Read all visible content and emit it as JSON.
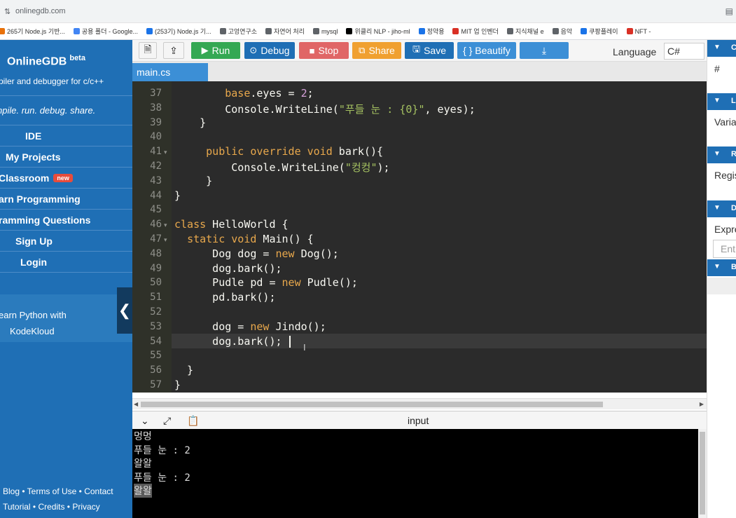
{
  "browser": {
    "url": "onlinegdb.com",
    "bookmarks": [
      {
        "label": "265기 Node.js 기반...",
        "icon_color": "#e8710a"
      },
      {
        "label": "공용 폴더 - Google...",
        "icon_color": "#4285f4"
      },
      {
        "label": "(253기) Node.js 기...",
        "icon_color": "#1a73e8"
      },
      {
        "label": "고엉연구소",
        "icon_color": "#5f6368"
      },
      {
        "label": "자연어 처리",
        "icon_color": "#5f6368"
      },
      {
        "label": "mysql",
        "icon_color": "#5f6368"
      },
      {
        "label": "위클리 NLP - jiho-ml",
        "icon_color": "#000000"
      },
      {
        "label": "정약용",
        "icon_color": "#1a73e8"
      },
      {
        "label": "MIT 업 인벤더",
        "icon_color": "#d93025"
      },
      {
        "label": "지식채널 e",
        "icon_color": "#5f6368"
      },
      {
        "label": "음악",
        "icon_color": "#5f6368"
      },
      {
        "label": "쿠팡플레이",
        "icon_color": "#1a73e8"
      },
      {
        "label": "NFT -",
        "icon_color": "#d93025"
      }
    ]
  },
  "sidebar": {
    "brand": "OnlineGDB",
    "brand_sup": "beta",
    "brand_sub": "piler and debugger for c/c++",
    "tagline": "npile. run. debug. share.",
    "nav": [
      {
        "label": "IDE"
      },
      {
        "label": "My Projects"
      },
      {
        "label": "Classroom",
        "badge": "new"
      },
      {
        "label": "arn Programming"
      },
      {
        "label": "ramming Questions"
      },
      {
        "label": "Sign Up"
      },
      {
        "label": "Login"
      }
    ],
    "ad_line1": "earn Python with",
    "ad_line2": "KodeKloud",
    "footer_line1": "Blog • Terms of Use • Contact",
    "footer_line2": "Tutorial • Credits • Privacy"
  },
  "toolbar": {
    "run": "Run",
    "debug": "Debug",
    "stop": "Stop",
    "share": "Share",
    "save": "Save",
    "beautify": "{ } Beautify",
    "language_label": "Language",
    "language_value": "C#",
    "colors": {
      "run": "#34a853",
      "debug": "#1f6fb5",
      "stop": "#e06666",
      "share": "#f0a030",
      "save": "#1f6fb5",
      "beautify": "#3c8fd6",
      "download": "#3c8fd6"
    }
  },
  "tab": {
    "filename": "main.cs"
  },
  "editor": {
    "lines": [
      {
        "n": "37",
        "fold": false,
        "segs": [
          {
            "t": "        "
          },
          {
            "t": "base",
            "c": "kw"
          },
          {
            "t": ".eyes = "
          },
          {
            "t": "2",
            "c": "num"
          },
          {
            "t": ";"
          }
        ]
      },
      {
        "n": "38",
        "fold": false,
        "segs": [
          {
            "t": "        Console.WriteLine("
          },
          {
            "t": "\"푸들 눈 : {0}\"",
            "c": "str"
          },
          {
            "t": ", eyes);"
          }
        ]
      },
      {
        "n": "39",
        "fold": false,
        "segs": [
          {
            "t": "    }"
          }
        ]
      },
      {
        "n": "40",
        "fold": false,
        "segs": [
          {
            "t": ""
          }
        ]
      },
      {
        "n": "41",
        "fold": true,
        "segs": [
          {
            "t": "     "
          },
          {
            "t": "public override void",
            "c": "kw"
          },
          {
            "t": " bark(){"
          }
        ]
      },
      {
        "n": "42",
        "fold": false,
        "segs": [
          {
            "t": "         Console.WriteLine("
          },
          {
            "t": "\"컹컹\"",
            "c": "str"
          },
          {
            "t": ");"
          }
        ]
      },
      {
        "n": "43",
        "fold": false,
        "segs": [
          {
            "t": "     }"
          }
        ]
      },
      {
        "n": "44",
        "fold": false,
        "segs": [
          {
            "t": "}"
          }
        ]
      },
      {
        "n": "45",
        "fold": false,
        "segs": [
          {
            "t": ""
          }
        ]
      },
      {
        "n": "46",
        "fold": true,
        "segs": [
          {
            "t": "class",
            "c": "kw"
          },
          {
            "t": " HelloWorld {"
          }
        ]
      },
      {
        "n": "47",
        "fold": true,
        "segs": [
          {
            "t": "  "
          },
          {
            "t": "static void",
            "c": "kw"
          },
          {
            "t": " Main() {"
          }
        ]
      },
      {
        "n": "48",
        "fold": false,
        "segs": [
          {
            "t": "      Dog dog = "
          },
          {
            "t": "new",
            "c": "kw"
          },
          {
            "t": " Dog();"
          }
        ]
      },
      {
        "n": "49",
        "fold": false,
        "segs": [
          {
            "t": "      dog.bark();"
          }
        ]
      },
      {
        "n": "50",
        "fold": false,
        "segs": [
          {
            "t": "      Pudle pd = "
          },
          {
            "t": "new",
            "c": "kw"
          },
          {
            "t": " Pudle();"
          }
        ]
      },
      {
        "n": "51",
        "fold": false,
        "segs": [
          {
            "t": "      pd.bark();"
          }
        ]
      },
      {
        "n": "52",
        "fold": false,
        "segs": [
          {
            "t": ""
          }
        ]
      },
      {
        "n": "53",
        "fold": false,
        "segs": [
          {
            "t": "      dog = "
          },
          {
            "t": "new",
            "c": "kw"
          },
          {
            "t": " Jindo();"
          }
        ]
      },
      {
        "n": "54",
        "fold": false,
        "segs": [
          {
            "t": "      dog.bark();"
          }
        ]
      },
      {
        "n": "55",
        "fold": false,
        "segs": [
          {
            "t": ""
          }
        ]
      },
      {
        "n": "56",
        "fold": false,
        "segs": [
          {
            "t": "  }"
          }
        ]
      },
      {
        "n": "57",
        "fold": false,
        "segs": [
          {
            "t": "}"
          }
        ]
      }
    ]
  },
  "console": {
    "title": "input",
    "output": [
      "멍멍",
      "푸들 눈 : 2",
      "왈왈",
      "푸들 눈 : 2",
      "왈왈"
    ]
  },
  "right_panel": {
    "sections": [
      {
        "title": "C",
        "body": "#"
      },
      {
        "title": "L",
        "body": "Varia"
      },
      {
        "title": "R",
        "body": "Regis"
      },
      {
        "title": "D",
        "body": "Expre",
        "input": "Ent"
      },
      {
        "title": "B",
        "body": ""
      }
    ]
  },
  "icons": {
    "folder": "folder-icon",
    "chevron_left": "chevron-left-icon",
    "chevron_down": "chevron-down-icon",
    "expand": "expand-icon",
    "copy": "copy-icon"
  }
}
